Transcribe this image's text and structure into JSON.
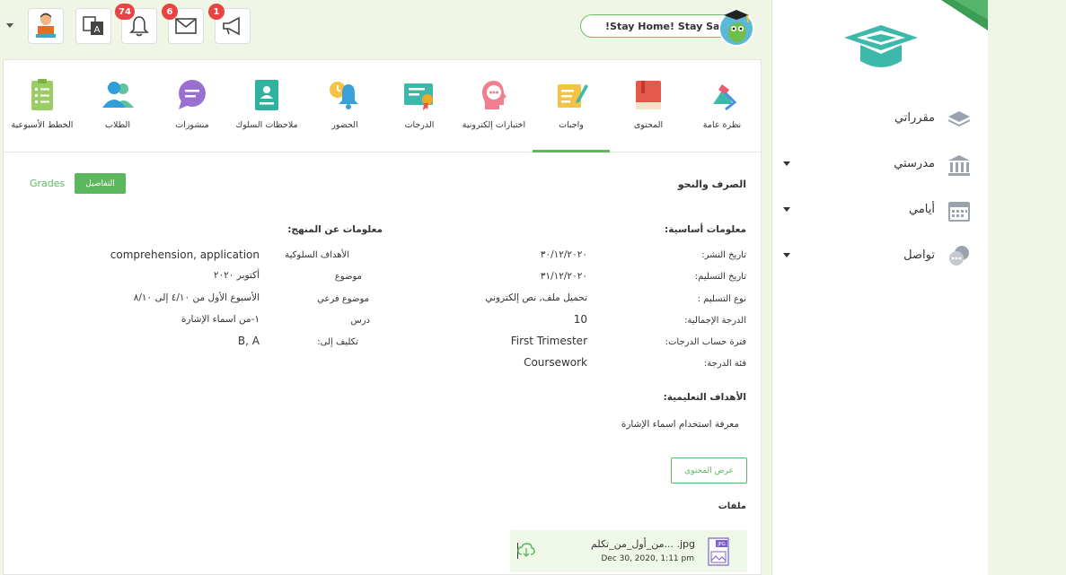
{
  "topbar": {
    "stay_home": "!Stay Home! Stay Safe",
    "announcements_badge": "1",
    "messages_badge": "6",
    "notifications_badge": "74"
  },
  "sidebar": {
    "items": [
      {
        "label": "مقرراتي"
      },
      {
        "label": "مدرستي"
      },
      {
        "label": "أيامي"
      },
      {
        "label": "تواصل"
      }
    ]
  },
  "tabs": [
    {
      "label": "نظرة عامة"
    },
    {
      "label": "المحتوى"
    },
    {
      "label": "واجبات"
    },
    {
      "label": "اختبارات إلكترونية"
    },
    {
      "label": "الدرجات"
    },
    {
      "label": "الحضور"
    },
    {
      "label": "ملاحظات السلوك"
    },
    {
      "label": "منشورات"
    },
    {
      "label": "الطلاب"
    },
    {
      "label": "الخطط الأسبوعية"
    }
  ],
  "main": {
    "title": "الصرف والنحو",
    "details_button": "التفاصيل",
    "grades_link": "Grades",
    "basic_info_heading": "معلومات أساسية:",
    "curriculum_heading": "معلومات عن المنهج:",
    "basic_info": [
      {
        "label": "تاريخ النشر:",
        "value": "٣٠/١٢/٢٠٢٠"
      },
      {
        "label": "تاريخ التسليم:",
        "value": "٣١/١٢/٢٠٢٠"
      },
      {
        "label": "نوع التسليم :",
        "value": "تحميل ملف, نص إلكتروني"
      },
      {
        "label": "الدرجة الإجمالية:",
        "value": "10"
      },
      {
        "label": "فترة حساب الدرجات:",
        "value": "First Trimester"
      },
      {
        "label": "فئة الدرجة:",
        "value": "Coursework"
      }
    ],
    "curriculum_info": [
      {
        "label": "الأهداف السلوكية",
        "value": "comprehension, application"
      },
      {
        "label": "موضوع",
        "value": "أكتوبر ٢٠٢٠"
      },
      {
        "label": "موضوع فرعي",
        "value": "الأسبوع الأول من ٤/١٠ إلى ٨/١٠"
      },
      {
        "label": "درس",
        "value": "١-من اسماء الإشارة"
      },
      {
        "label": "تكليف إلى:",
        "value": "B, A"
      }
    ],
    "objectives_heading": "الأهداف التعليمية:",
    "objectives_text": "معرفة استخدام اسماء الإشارة",
    "view_content_button": "عرض المحتوى",
    "attachments_heading": "ملفات",
    "attachment": {
      "name": "من_أول_من_تكلم... .jpg",
      "date": "Dec 30, 2020, 1:11 pm",
      "type_badge": "JPG"
    }
  },
  "colors": {
    "accent": "#5cb85c",
    "badge": "#e84343",
    "background": "#eff6e6"
  }
}
